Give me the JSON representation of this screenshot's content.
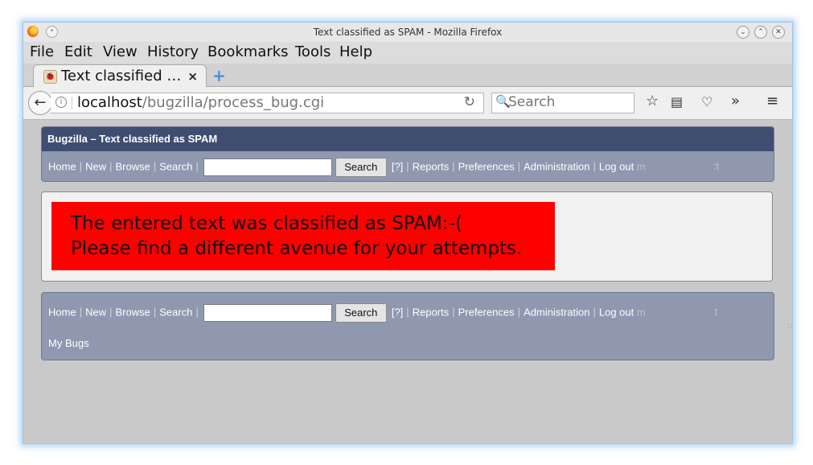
{
  "window": {
    "title": "Text classified as SPAM - Mozilla Firefox"
  },
  "menu": [
    "File",
    "Edit",
    "View",
    "History",
    "Bookmarks",
    "Tools",
    "Help"
  ],
  "tab": {
    "label": "Text classified …",
    "close": "×"
  },
  "nav": {
    "url_host": "localhost",
    "url_path": "/bugzilla/process_bug.cgi",
    "search_placeholder": "Search"
  },
  "bugzilla": {
    "header_title": "Bugzilla – Text classified as SPAM",
    "links": {
      "home": "Home",
      "new": "New",
      "browse": "Browse",
      "search": "Search",
      "search_button": "Search",
      "help": "[?]",
      "reports": "Reports",
      "preferences": "Preferences",
      "administration": "Administration",
      "logout": "Log out",
      "logout_trail": "m",
      "trail_top": ":t",
      "trail_bottom": "t",
      "my_bugs": "My Bugs"
    },
    "message_line1": "The entered text was classified as SPAM:-(",
    "message_line2": "Please find a different avenue for your attempts."
  },
  "colors": {
    "header_bg": "#3f4e70",
    "linkbar_bg": "#8f98af",
    "spam_bg": "#ff0000"
  }
}
